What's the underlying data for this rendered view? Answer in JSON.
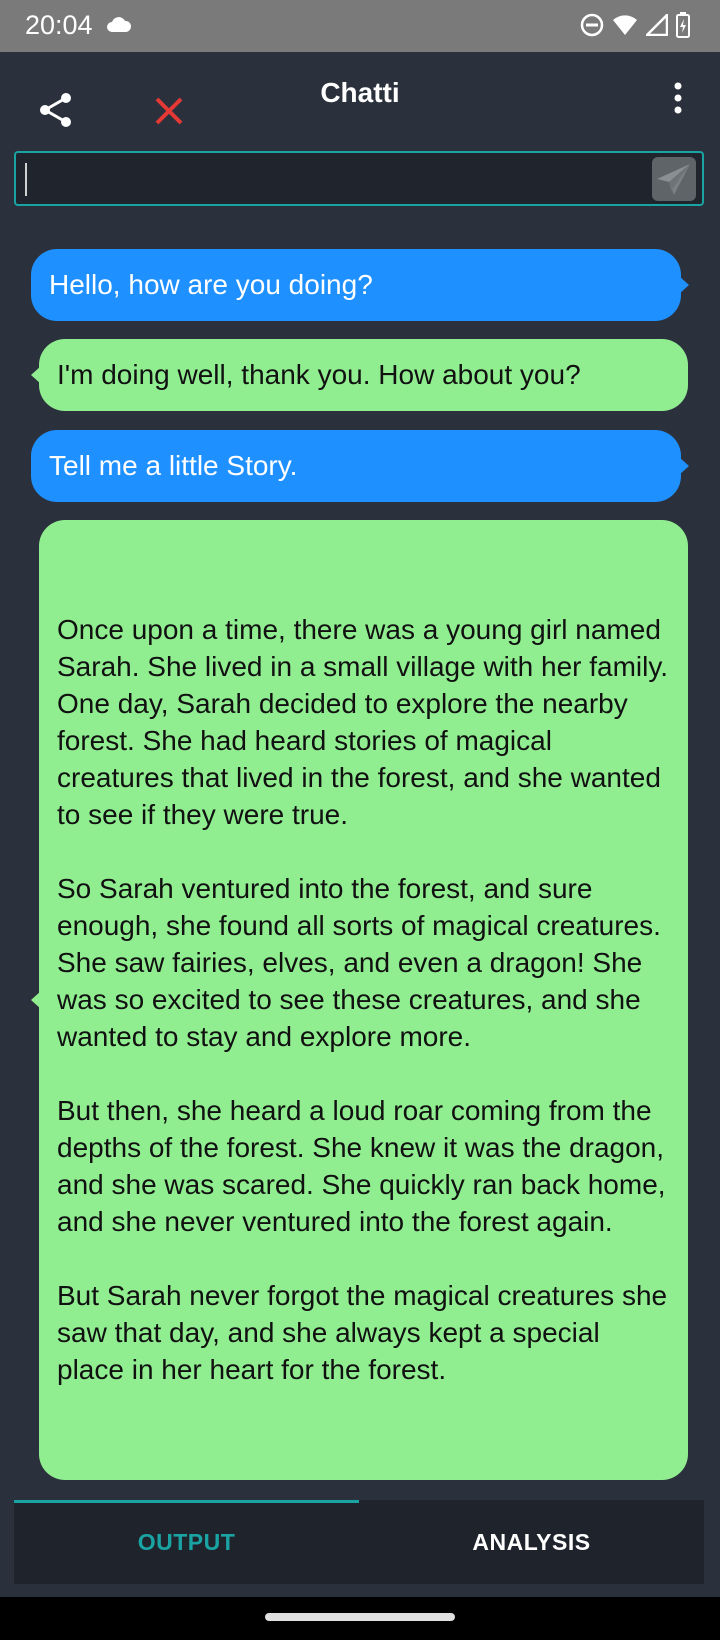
{
  "status_bar": {
    "time": "20:04",
    "icons": [
      "cloud-icon",
      "dnd-icon",
      "wifi-icon",
      "signal-icon",
      "battery-icon"
    ]
  },
  "app_bar": {
    "title": "Chatti",
    "icons": [
      "share-icon",
      "close-icon",
      "more-vert-icon"
    ],
    "close_color": "#e53935"
  },
  "input": {
    "value": "",
    "send_icon": "send-icon",
    "border_color": "#1aa3a3"
  },
  "messages": [
    {
      "role": "user",
      "text": "Hello, how are you doing?"
    },
    {
      "role": "bot",
      "text": "I'm doing well, thank you. How about you?"
    },
    {
      "role": "user",
      "text": "Tell me a little Story."
    },
    {
      "role": "bot",
      "text": "Once upon a time, there was a young girl named Sarah. She lived in a small village with her family. One day, Sarah decided to explore the nearby forest. She had heard stories of magical creatures that lived in the forest, and she wanted to see if they were true.\n\nSo Sarah ventured into the forest, and sure enough, she found all sorts of magical creatures. She saw fairies, elves, and even a dragon! She was so excited to see these creatures, and she wanted to stay and explore more.\n\nBut then, she heard a loud roar coming from the depths of the forest. She knew it was the dragon, and she was scared. She quickly ran back home, and she never ventured into the forest again.\n\nBut Sarah never forgot the magical creatures she saw that day, and she always kept a special place in her heart for the forest."
    }
  ],
  "colors": {
    "user_bubble": "#1e90ff",
    "bot_bubble": "#90ee90",
    "background": "#2b313c",
    "accent": "#1aa3a3"
  },
  "tabs": [
    {
      "label": "OUTPUT",
      "active": true
    },
    {
      "label": "ANALYSIS",
      "active": false
    }
  ]
}
